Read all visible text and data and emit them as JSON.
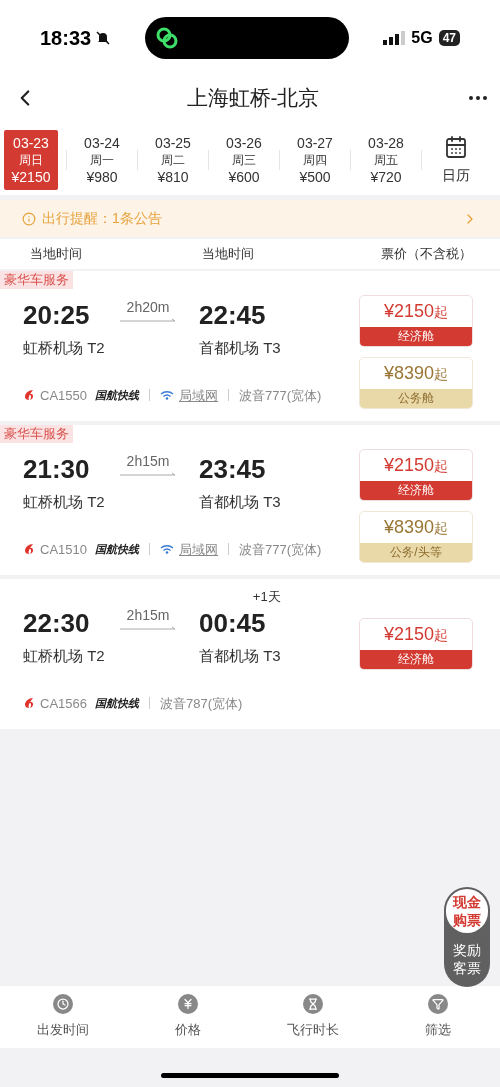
{
  "status_bar": {
    "time": "18:33",
    "network": "5G",
    "battery": "47"
  },
  "header": {
    "title": "上海虹桥-北京"
  },
  "dates": [
    {
      "date": "03-23",
      "weekday": "周日",
      "price": "¥2150",
      "selected": true
    },
    {
      "date": "03-24",
      "weekday": "周一",
      "price": "¥980",
      "selected": false
    },
    {
      "date": "03-25",
      "weekday": "周二",
      "price": "¥810",
      "selected": false
    },
    {
      "date": "03-26",
      "weekday": "周三",
      "price": "¥600",
      "selected": false
    },
    {
      "date": "03-27",
      "weekday": "周四",
      "price": "¥500",
      "selected": false
    },
    {
      "date": "03-28",
      "weekday": "周五",
      "price": "¥720",
      "selected": false
    }
  ],
  "calendar_button": {
    "label": "日历"
  },
  "notice": {
    "text": "出行提醒：1条公告"
  },
  "columns": [
    "当地时间",
    "当地时间",
    "票价（不含税）"
  ],
  "flights": [
    {
      "tag": "豪华车服务",
      "depart": "20:25",
      "duration": "2h20m",
      "arrive": "22:45",
      "from": "虹桥机场 T2",
      "to": "首都机场 T3",
      "flight_no": "CA1550",
      "brand": "国航快线",
      "wifi": {
        "text": "局域网"
      },
      "aircraft": "波音777(宽体)",
      "fares": [
        {
          "kind": "economy",
          "price": "¥2150",
          "suffix": "起",
          "cabin": "经济舱"
        },
        {
          "kind": "business",
          "price": "¥8390",
          "suffix": "起",
          "cabin": "公务舱"
        }
      ]
    },
    {
      "tag": "豪华车服务",
      "depart": "21:30",
      "duration": "2h15m",
      "arrive": "23:45",
      "from": "虹桥机场 T2",
      "to": "首都机场 T3",
      "flight_no": "CA1510",
      "brand": "国航快线",
      "wifi": {
        "text": "局域网"
      },
      "aircraft": "波音777(宽体)",
      "fares": [
        {
          "kind": "economy",
          "price": "¥2150",
          "suffix": "起",
          "cabin": "经济舱"
        },
        {
          "kind": "business",
          "price": "¥8390",
          "suffix": "起",
          "cabin": "公务/头等"
        }
      ]
    },
    {
      "depart": "22:30",
      "duration": "2h15m",
      "arrive": "00:45",
      "day_offset": "+1天",
      "from": "虹桥机场 T2",
      "to": "首都机场 T3",
      "flight_no": "CA1566",
      "brand": "国航快线",
      "aircraft": "波音787(宽体)",
      "fares": [
        {
          "kind": "economy",
          "price": "¥2150",
          "suffix": "起",
          "cabin": "经济舱"
        }
      ]
    }
  ],
  "floating_toggle": {
    "options": [
      {
        "label": "现金购票",
        "selected": true
      },
      {
        "label": "奖励客票",
        "selected": false
      }
    ]
  },
  "bottom_bar": [
    {
      "kind": "clock",
      "label": "出发时间"
    },
    {
      "kind": "price",
      "label": "价格"
    },
    {
      "kind": "duration",
      "label": "飞行时长"
    },
    {
      "kind": "filter",
      "label": "筛选"
    }
  ]
}
